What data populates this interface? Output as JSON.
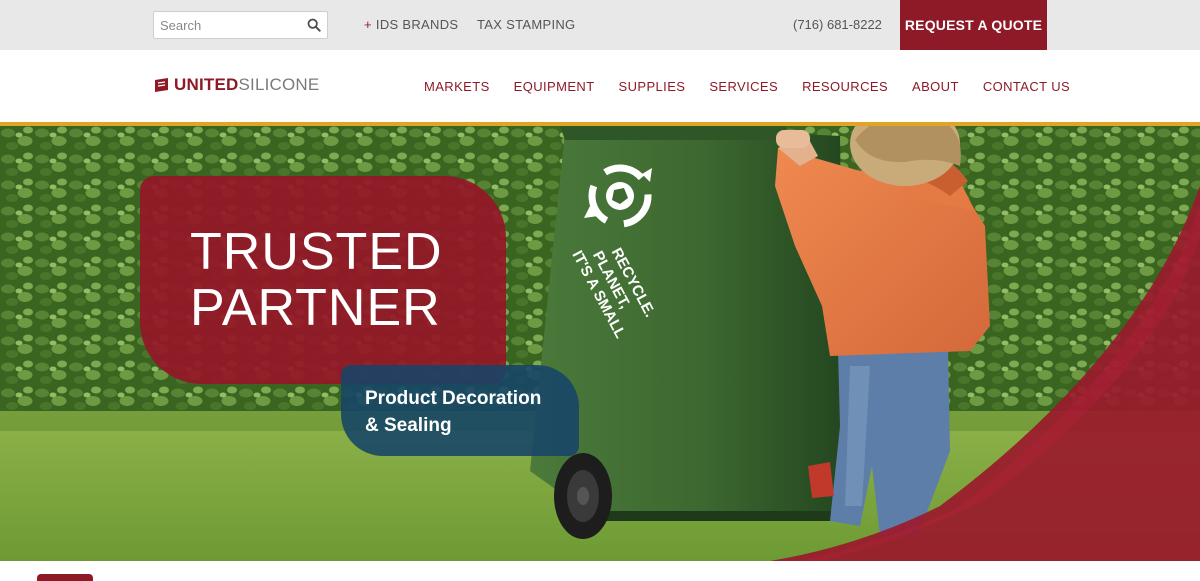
{
  "utility": {
    "search_placeholder": "Search",
    "ids_plus": "+",
    "ids_brands": "IDS BRANDS",
    "tax_stamping": "TAX STAMPING",
    "phone": "(716) 681-8222",
    "quote_label": "REQUEST A QUOTE"
  },
  "brand": {
    "logo_part1": "UNITED",
    "logo_part2": "SILICONE",
    "primary_color": "#8e1a28",
    "secondary_color": "#164468",
    "accent_color": "#e2a427"
  },
  "nav": {
    "items": [
      "MARKETS",
      "EQUIPMENT",
      "SUPPLIES",
      "SERVICES",
      "RESOURCES",
      "ABOUT",
      "CONTACT US"
    ]
  },
  "hero": {
    "headline_line1": "TRUSTED",
    "headline_line2": "PARTNER",
    "sub_line1": "Product Decoration",
    "sub_line2": "& Sealing",
    "bin_text_line1": "IT'S A SMALL",
    "bin_text_line2": "PLANET,",
    "bin_text_line3": "RECYCLE."
  }
}
